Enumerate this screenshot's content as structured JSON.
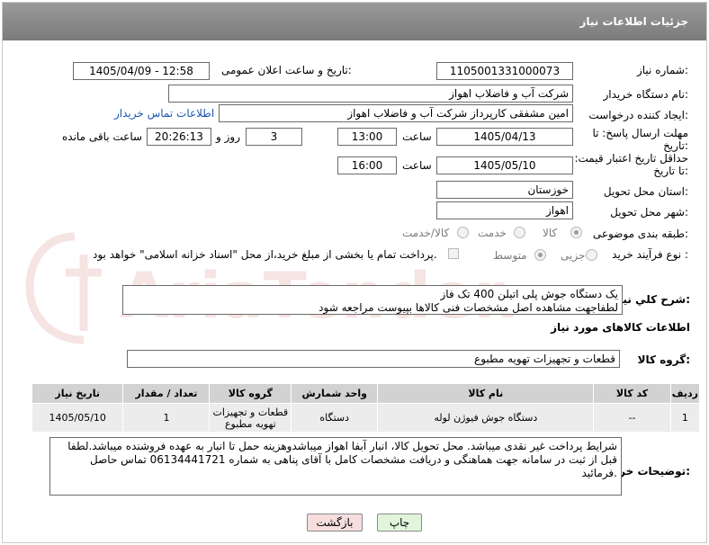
{
  "header": {
    "title": "جزئیات اطلاعات نیاز"
  },
  "labels": {
    "need_number": "شماره نیاز:",
    "announce_datetime": "تاریخ و ساعت اعلان عمومی:",
    "buyer_org": "نام دستگاه خریدار:",
    "requester": "ایجاد کننده درخواست:",
    "reply_deadline": "مهلت ارسال پاسخ: تا تاریخ:",
    "price_validity": "حداقل تاریخ اعتبار قیمت: تا تاریخ:",
    "time": "ساعت",
    "day_and": "روز و",
    "remaining": "ساعت باقی مانده",
    "province": "استان محل تحویل:",
    "city": "شهر محل تحویل:",
    "category": "طبقه بندی موضوعی:",
    "purchase_type": "نوع فرآیند خرید :",
    "description": "شرح کلي نياز:",
    "goods_info": "اطلاعات کالاهای مورد نیاز",
    "goods_group": "گروه کالا:",
    "buyer_notes": "توضیحات خریدار:"
  },
  "fields": {
    "need_number": "1105001331000073",
    "announce_datetime": "1405/04/09 - 12:58",
    "buyer_org": "شرکت آب و فاضلاب اهواز",
    "requester": "امین مشفقی کارپرداز شرکت آب و فاضلاب اهواز",
    "contact_link": "اطلاعات تماس خریدار",
    "reply_date": "1405/04/13",
    "reply_time": "13:00",
    "days": "3",
    "remaining_time": "20:26:13",
    "validity_date": "1405/05/10",
    "validity_time": "16:00",
    "province": "خوزستان",
    "city": "اهواز",
    "goods_group": "قطعات و تجهیزات تهویه مطبوع"
  },
  "category_options": [
    {
      "label": "کالا",
      "selected": true
    },
    {
      "label": "خدمت",
      "selected": false
    },
    {
      "label": "کالا/خدمت",
      "selected": false
    }
  ],
  "purchase_options": [
    {
      "label": "جزیی",
      "selected": false
    },
    {
      "label": "متوسط",
      "selected": true
    }
  ],
  "payment_note": "پرداخت تمام یا بخشی از مبلغ خرید،از محل \"اسناد خزانه اسلامی\" خواهد بود.",
  "description_lines": [
    "یک دستگاه جوش پلی اتیلن 400 تک فاز",
    "لطفاجهت مشاهده اصل مشخصات فنی کالاها بپیوست مراجعه شود"
  ],
  "table": {
    "headers": [
      "ردیف",
      "کد کالا",
      "نام کالا",
      "واحد شمارش",
      "گروه کالا",
      "تعداد / مقدار",
      "تاریخ نیاز"
    ],
    "rows": [
      [
        "1",
        "--",
        "دستگاه جوش فیوژن لوله",
        "دستگاه",
        "قطعات و تجهیزات تهویه مطبوع",
        "1",
        "1405/05/10"
      ]
    ]
  },
  "buyer_notes_text": "شرایط پرداخت غیر نقدی میباشد. محل تحویل کالا، انبار آبفا اهواز میباشدوهزینه حمل تا انبار به عهده فروشنده میباشد.لطفا قبل از ثبت در سامانه جهت هماهنگی و دریافت مشخصات کامل با آقای  پناهی به شماره 06134441721  تماس حاصل فرمائید.",
  "buttons": {
    "print": "چاپ",
    "back": "بازگشت"
  },
  "watermark_text": "AriaTender.net",
  "colors": {
    "header_bg": "#8a8a8a",
    "link": "#1b57b2",
    "back_button": "#f6dede",
    "print_button": "#e2f5dc"
  }
}
